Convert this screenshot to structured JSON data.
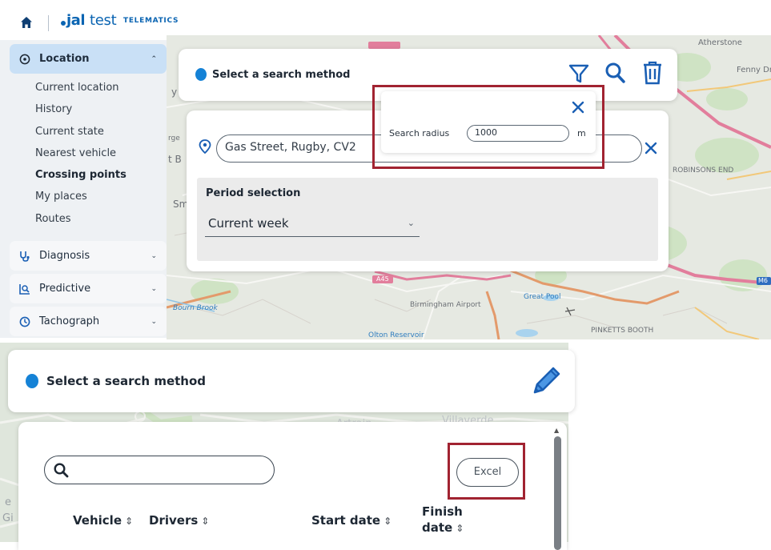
{
  "header": {
    "brand_jal": "jal",
    "brand_test": "test",
    "brand_suffix": "TELEMATICS"
  },
  "sidebar": {
    "location": {
      "label": "Location",
      "expanded": true
    },
    "location_items": [
      {
        "label": "Current location",
        "active": false
      },
      {
        "label": "History",
        "active": false
      },
      {
        "label": "Current state",
        "active": false
      },
      {
        "label": "Nearest vehicle",
        "active": false
      },
      {
        "label": "Crossing points",
        "active": true
      },
      {
        "label": "My places",
        "active": false
      },
      {
        "label": "Routes",
        "active": false
      }
    ],
    "diagnosis": "Diagnosis",
    "predictive": "Predictive",
    "tachograph": "Tachograph"
  },
  "map_top": {
    "labels": {
      "atherstone": "Atherstone",
      "fenny": "Fenny Dr",
      "robinsons_end": "ROBINSONS END",
      "road_a45": "A45",
      "birmingham_airport": "Birmingham Airport",
      "great_pool": "Great Pool",
      "pinketts_booth": "PINKETTS BOOTH",
      "olton_reservoir": "Olton Reservoir",
      "bourn_brook": "Bourn Brook",
      "m6": "M6",
      "sm": "Sm",
      "st_b": "t B",
      "y_frag": "y",
      "rge": "rge"
    }
  },
  "search_panel_top": {
    "title": "Select a search method",
    "icons": [
      "filter-icon",
      "search-icon",
      "trash-icon"
    ]
  },
  "radius_popup": {
    "label": "Search radius",
    "value": "1000",
    "unit": "m"
  },
  "address": {
    "value": "Gas Street, Rugby, CV2"
  },
  "period": {
    "label": "Period selection",
    "selected": "Current week"
  },
  "search_panel_bottom": {
    "title": "Select a search method",
    "edit_icon": "pencil-icon"
  },
  "map_bottom": {
    "labels": {
      "artrain": "Artrain",
      "villaverde": "Villaverde",
      "ge": "e",
      "gi": "Gi"
    }
  },
  "results": {
    "search_placeholder": "",
    "excel_label": "Excel",
    "columns": [
      "Vehicle",
      "Drivers",
      "Start date",
      "Finish date"
    ],
    "finish_line1": "Finish",
    "finish_line2": "date"
  },
  "colors": {
    "accent_blue": "#1582d6",
    "brand_blue": "#0a64b2",
    "icon_blue": "#1a5fb4",
    "highlight_red": "#a12331",
    "sidebar_active": "#c9e0f6"
  }
}
